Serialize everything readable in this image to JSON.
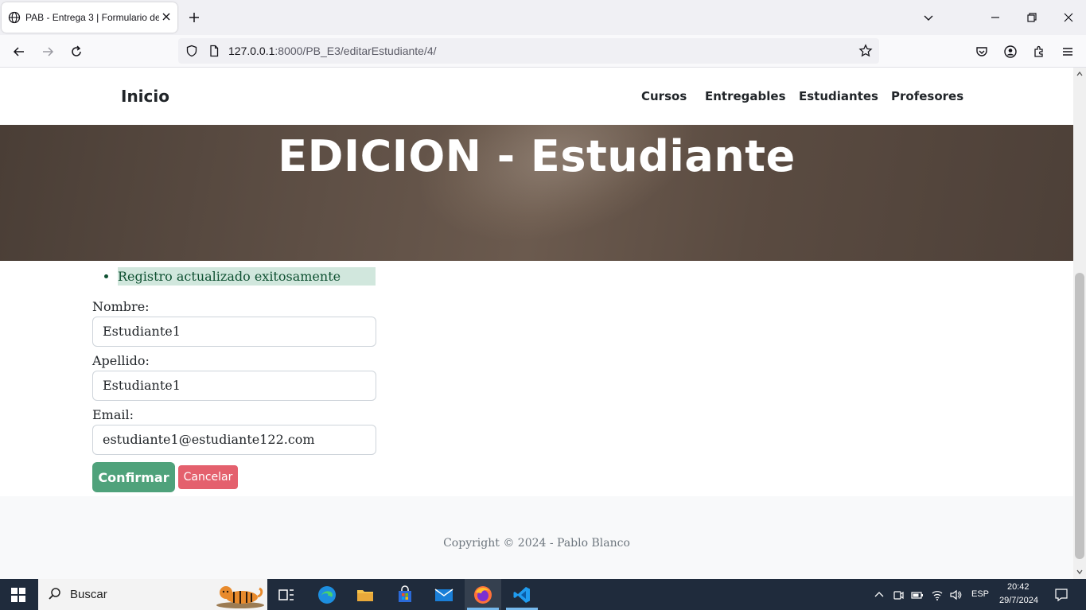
{
  "browser": {
    "tab_title": "PAB - Entrega 3 | Formulario de",
    "url_host": "127.0.0.1",
    "url_rest": ":8000/PB_E3/editarEstudiante/4/"
  },
  "site": {
    "brand": "Inicio",
    "menu": [
      "Cursos",
      "Entregables",
      "Estudiantes",
      "Profesores"
    ],
    "heading": "EDICION - Estudiante"
  },
  "form": {
    "message": "Registro actualizado exitosamente",
    "nombre_label": "Nombre:",
    "nombre_value": "Estudiante1",
    "apellido_label": "Apellido:",
    "apellido_value": "Estudiante1",
    "email_label": "Email:",
    "email_value": "estudiante1@estudiante122.com",
    "confirm_label": "Confirmar",
    "cancel_label": "Cancelar"
  },
  "footer": {
    "copyright": "Copyright © 2024 - Pablo Blanco"
  },
  "taskbar": {
    "search_text": "Buscar",
    "language": "ESP",
    "time": "20:42",
    "date": "29/7/2024"
  },
  "colors": {
    "confirm": "#4fa27b",
    "cancel": "#e4606d",
    "success_bg": "#d1e7dd",
    "taskbar": "#1f2b3c"
  }
}
